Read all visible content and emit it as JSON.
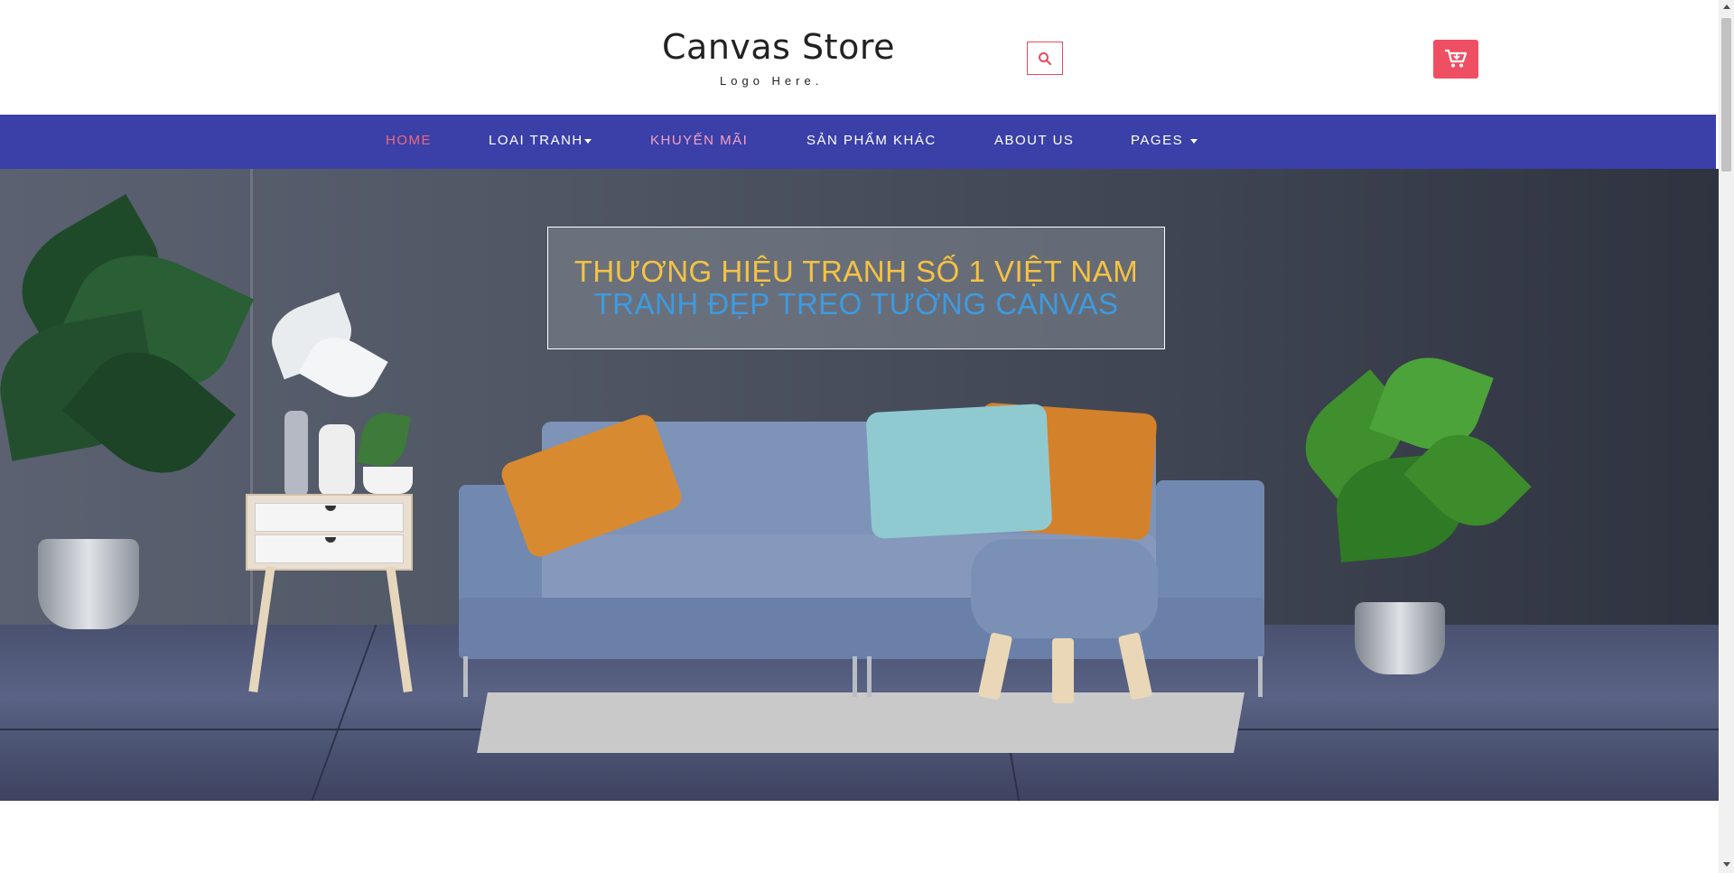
{
  "header": {
    "store_name": "Canvas Store",
    "logo_sub": "Logo Here.",
    "search_icon": "search-icon",
    "cart_icon": "cart-icon"
  },
  "nav": {
    "items": [
      {
        "label": "HOME",
        "active": true
      },
      {
        "label": "LOAI TRANH",
        "dropdown": true
      },
      {
        "label": "KHUYẾN MÃI"
      },
      {
        "label": "SẢN PHẨM KHÁC"
      },
      {
        "label": "ABOUT US"
      },
      {
        "label": "PAGES",
        "dropdown": true
      }
    ]
  },
  "hero": {
    "line1": "THƯƠNG HIỆU TRANH SỐ 1 VIỆT NAM",
    "line2": "TRANH ĐẸP TREO TƯỜNG CANVAS"
  },
  "colors": {
    "nav_bg": "#3a40a7",
    "accent": "#ef4f63",
    "banner_line1": "#f5c242",
    "banner_line2": "#3e9ae0"
  }
}
